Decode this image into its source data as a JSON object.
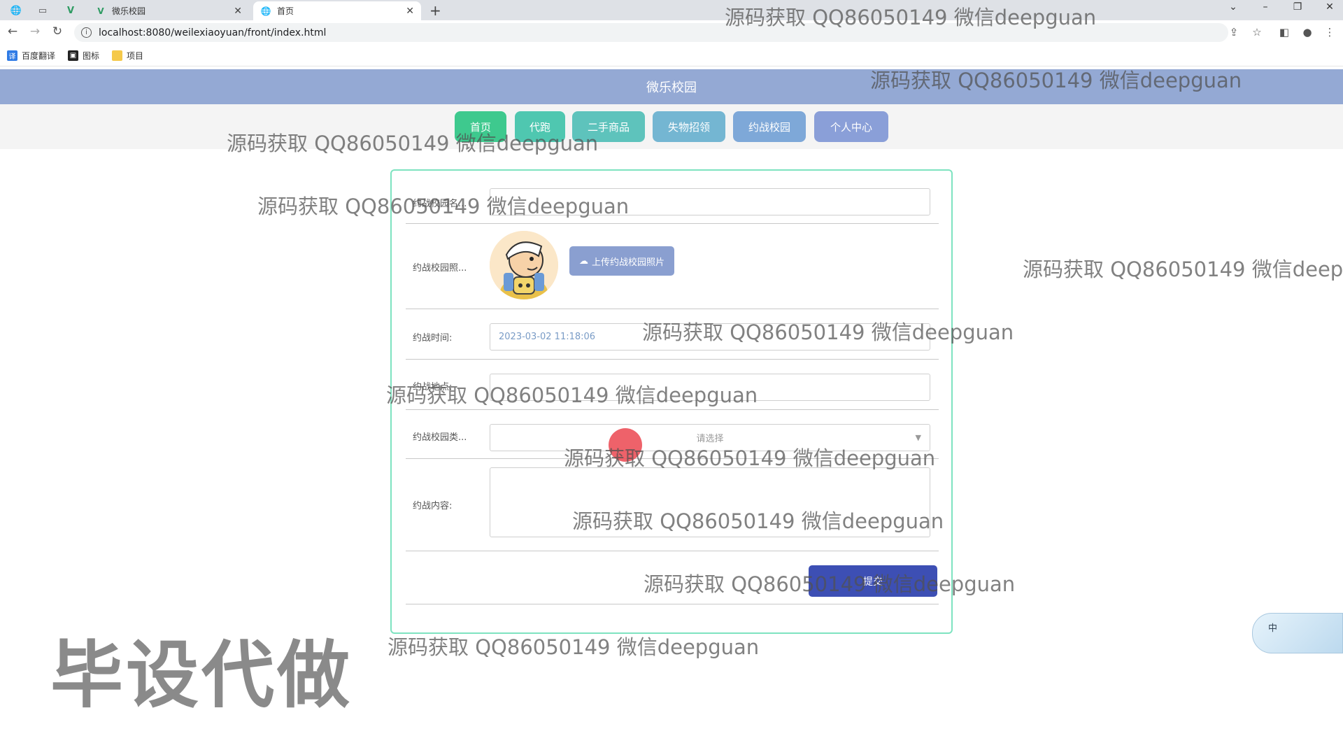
{
  "browser": {
    "tabs": [
      {
        "title": "微乐校园",
        "active": false
      },
      {
        "title": "首页",
        "active": true
      }
    ],
    "url": "localhost:8080/weilexiaoyuan/front/index.html",
    "bookmarks": [
      "百度翻译",
      "图标",
      "项目"
    ]
  },
  "site": {
    "title": "微乐校园",
    "nav": [
      "首页",
      "代跑",
      "二手商品",
      "失物招领",
      "约战校园",
      "个人中心"
    ]
  },
  "form": {
    "name_label": "约战校园名...",
    "photo_label": "约战校园照...",
    "upload_label": "上传约战校园照片",
    "time_label": "约战时间:",
    "time_value": "2023-03-02 11:18:06",
    "place_label": "约战地点:",
    "type_label": "约战校园类...",
    "type_placeholder": "请选择",
    "content_label": "约战内容:",
    "submit_label": "提交"
  },
  "watermark": "源码获取 QQ86050149 微信deepguan",
  "stamp": "毕设代做",
  "ime_label": "中",
  "colors": {
    "header": "#94a9d4",
    "nav_active": "#3ec98e",
    "nav_button": "#7ea8d8",
    "card_border": "#7ee3c0",
    "submit": "#3d4fb4",
    "upload": "#8a9fd0"
  }
}
